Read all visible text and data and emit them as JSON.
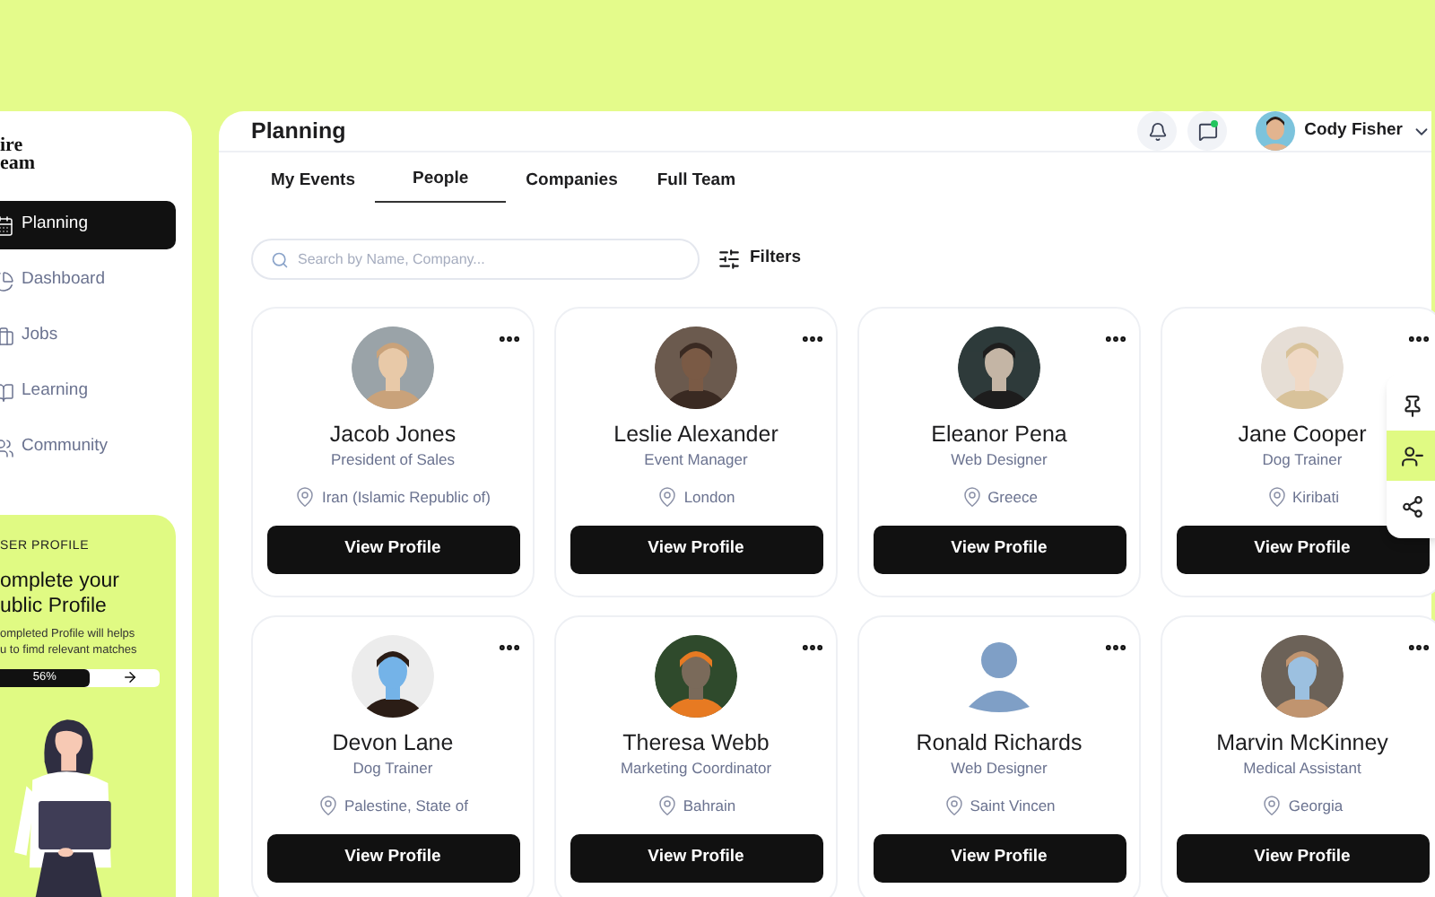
{
  "sidebar": {
    "logo": [
      "ire",
      "eam"
    ],
    "items": [
      {
        "label": "Planning",
        "selected": true
      },
      {
        "label": "Dashboard",
        "selected": false
      },
      {
        "label": "Jobs",
        "selected": false
      },
      {
        "label": "Learning",
        "selected": false
      },
      {
        "label": "Community",
        "selected": false
      }
    ],
    "profile_card": {
      "eyebrow": "SER PROFILE",
      "title": [
        "omplete your",
        "ublic Profile"
      ],
      "text": [
        "ompleted Profile will helps",
        "u to fimd relevant matches"
      ],
      "progress": {
        "reading": "56%",
        "level": 0.56
      }
    }
  },
  "header": {
    "title": "Planning",
    "notifications_dot": true,
    "user": {
      "name": "Cody Fisher"
    }
  },
  "tabs": [
    {
      "label": "My Events",
      "selected": false
    },
    {
      "label": "People",
      "selected": true
    },
    {
      "label": "Companies",
      "selected": false
    },
    {
      "label": "Full Team",
      "selected": false
    }
  ],
  "search": {
    "placeholder": "Search by Name, Company..."
  },
  "filters": {
    "label": "Filters"
  },
  "people": [
    {
      "name": "Jacob Jones",
      "role": "President of Sales",
      "location": "Iran (Islamic Republic of)",
      "button": "View Profile"
    },
    {
      "name": "Leslie Alexander",
      "role": "Event Manager",
      "location": "London",
      "button": "View Profile"
    },
    {
      "name": "Eleanor Pena",
      "role": "Web Designer",
      "location": "Greece",
      "button": "View Profile"
    },
    {
      "name": "Jane Cooper",
      "role": "Dog Trainer",
      "location": "Kiribati",
      "button": "View Profile"
    },
    {
      "name": "Devon Lane",
      "role": "Dog Trainer",
      "location": "Palestine, State of",
      "button": "View Profile"
    },
    {
      "name": "Theresa Webb",
      "role": "Marketing Coordinator",
      "location": "Bahrain",
      "button": "View Profile"
    },
    {
      "name": "Ronald Richards",
      "role": "Web Designer",
      "location": "Saint Vincen",
      "avatar": {
        "kind": "placeholder"
      },
      "button": "View Profile"
    },
    {
      "name": "Marvin McKinney",
      "role": "Medical Assistant",
      "location": "Georgia",
      "button": "View Profile"
    }
  ],
  "card_actions": [
    {
      "kind": "pin",
      "selected": false
    },
    {
      "kind": "remove-user",
      "selected": true
    },
    {
      "kind": "share",
      "selected": false
    }
  ]
}
